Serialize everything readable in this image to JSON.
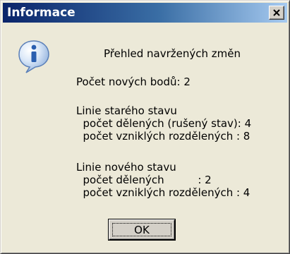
{
  "window": {
    "title": "Informace",
    "close_label": "X"
  },
  "icon": {
    "name": "info-icon",
    "glyph": "i",
    "color": "#2a5fb0"
  },
  "message": {
    "heading": "Přehled navržených změn",
    "new_points": "Počet nových bodů: 2",
    "old_section_title": "Linie starého stavu",
    "old_divided": "  počet dělených (rušený stav): 4",
    "old_created": "  počet vzniklých rozdělených : 8",
    "new_section_title": "Linie nového stavu",
    "new_divided": "  počet dělených          : 2",
    "new_created": "  počet vzniklých rozdělených : 4"
  },
  "buttons": {
    "ok": "OK"
  }
}
